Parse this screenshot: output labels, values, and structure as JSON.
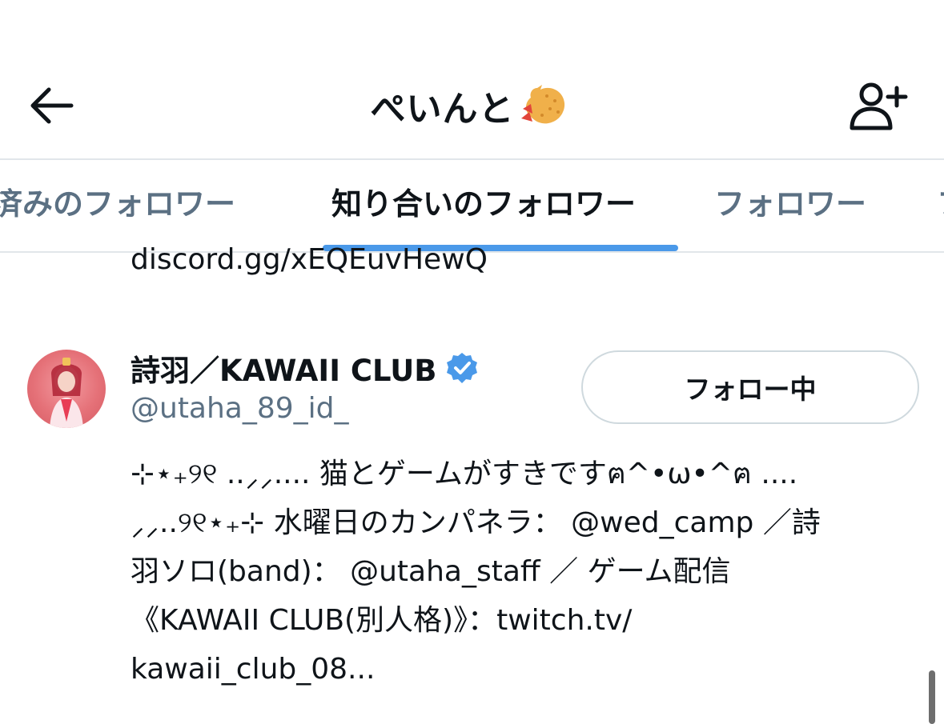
{
  "header": {
    "back_icon": "arrow-left-icon",
    "title": "ぺいんと",
    "title_emoji": "fried-shrimp-emoji",
    "add_user_icon": "add-user-icon"
  },
  "tabs": [
    {
      "label": "済みのフォロワー",
      "active": false
    },
    {
      "label": "知り合いのフォロワー",
      "active": true
    },
    {
      "label": "フォロワー",
      "active": false
    },
    {
      "label": "フ",
      "active": false
    }
  ],
  "accent_color": "#4a99e9",
  "previous_item": {
    "bio_tail": "discord.gg/xEQEuvHewQ"
  },
  "user": {
    "name": "詩羽／KAWAII CLUB",
    "verified": true,
    "handle": "@utaha_89_id_",
    "follow_button_label": "フォロー中",
    "bio_lines": [
      "⊹⋆₊୨୧ ..⸝⸝.... 猫とゲームがすきですฅ^•ω•^ฅ ....",
      "⸝⸝..୨୧⋆₊⊹ 水曜日のカンパネラ： @wed_camp ／詩",
      "羽ソロ(band)： @utaha_staff ／ ゲーム配信",
      "《KAWAII CLUB(別人格)》：twitch.tv/",
      "kawaii_club_08..."
    ]
  }
}
